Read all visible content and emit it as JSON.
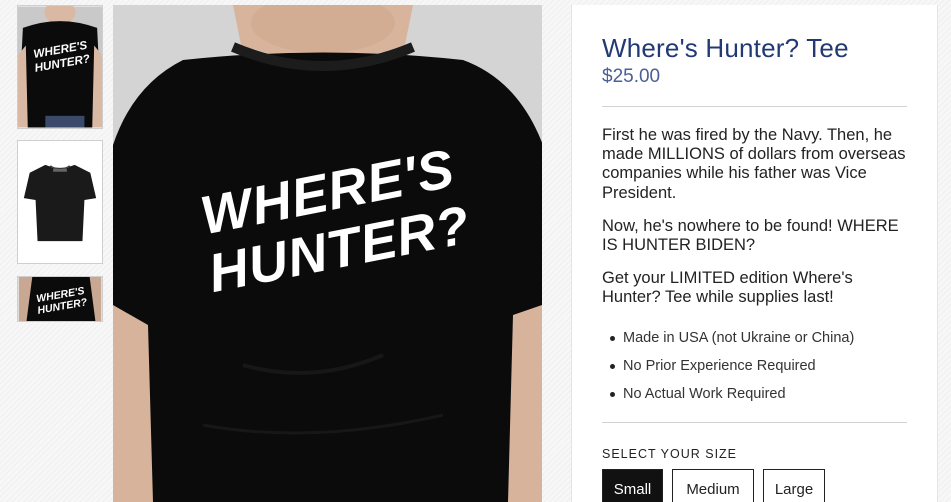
{
  "product": {
    "title": "Where's Hunter? Tee",
    "price": "$25.00",
    "shirt_graphic_line1": "WHERE'S",
    "shirt_graphic_line2": "HUNTER?",
    "description": [
      "First he was fired by the Navy. Then, he made MILLIONS of dollars from overseas companies while his father was Vice President.",
      "Now, he's nowhere to be found! WHERE IS HUNTER BIDEN?",
      "Get your LIMITED edition Where's Hunter? Tee while supplies last!"
    ],
    "features": [
      "Made in USA (not Ukraine or China)",
      "No Prior Experience Required",
      "No Actual Work Required"
    ],
    "size_label": "SELECT YOUR SIZE",
    "sizes": [
      "Small",
      "Medium",
      "Large"
    ],
    "selected_size": "Small"
  },
  "colors": {
    "title": "#223a73",
    "price": "#4a5f93",
    "shirt": "#0b0b0b",
    "selected_size_bg": "#111111"
  }
}
